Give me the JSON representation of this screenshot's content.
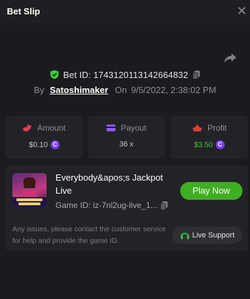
{
  "header": {
    "title": "Bet Slip"
  },
  "bet": {
    "id_label": "Bet ID: 1743120113142664832",
    "by_label": "By",
    "user": "Satoshimaker",
    "on_label": "On",
    "datetime": "9/5/2022, 2:38:02 PM"
  },
  "stats": {
    "amount": {
      "label": "Amount",
      "value": "$0.10"
    },
    "payout": {
      "label": "Payout",
      "value": "36 x"
    },
    "profit": {
      "label": "Profit",
      "value": "$3.50"
    }
  },
  "game": {
    "name": "Everybody&apos;s Jackpot Live",
    "id_text": "Game ID: iz-7nl2ug-live_1...",
    "play_label": "Play Now"
  },
  "support": {
    "note": "Any issues, please contact the customer service for help and provide the game ID.",
    "button_label": "Live Support"
  },
  "colors": {
    "accent_green": "#3fae22",
    "profit_green": "#3fc93a",
    "coin_purple": "#7b3cf0",
    "amount_red": "#e8405a",
    "payout_purple": "#8a5cf6",
    "profit_red": "#e23c3c"
  },
  "icons": {
    "close": "close-icon",
    "share": "share-icon",
    "shield": "shield-check-icon",
    "copy": "copy-icon",
    "amount": "coins-icon",
    "payout": "wallet-icon",
    "profit": "crown-icon",
    "headset": "headset-icon"
  }
}
